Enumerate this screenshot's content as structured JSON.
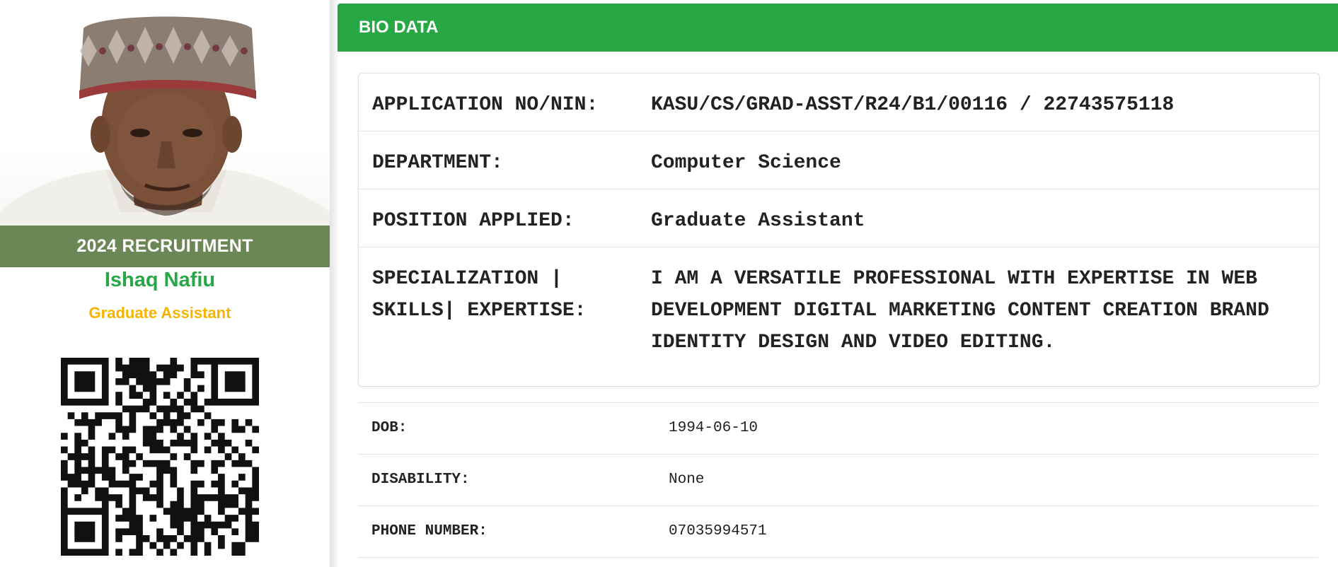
{
  "profile": {
    "banner": "2024 RECRUITMENT",
    "name": "Ishaq Nafiu",
    "role": "Graduate Assistant"
  },
  "bio": {
    "title": "BIO DATA",
    "card_rows": [
      {
        "label": "APPLICATION NO/NIN:",
        "value": "KASU/CS/GRAD-ASST/R24/B1/00116 / 22743575118"
      },
      {
        "label": "DEPARTMENT:",
        "value": "Computer Science"
      },
      {
        "label": "POSITION APPLIED:",
        "value": "Graduate Assistant"
      },
      {
        "label": "SPECIALIZATION | SKILLS| EXPERTISE:",
        "value": "I AM A VERSATILE PROFESSIONAL WITH EXPERTISE IN WEB DEVELOPMENT DIGITAL MARKETING CONTENT CREATION BRAND IDENTITY DESIGN AND VIDEO EDITING."
      }
    ],
    "details": [
      {
        "label": "DOB:",
        "value": "1994-06-10"
      },
      {
        "label": "DISABILITY:",
        "value": "None"
      },
      {
        "label": "PHONE NUMBER:",
        "value": "07035994571"
      }
    ]
  },
  "colors": {
    "header_green": "#28a745",
    "name_green": "#28a745",
    "role_yellow": "#f4b400",
    "banner_overlay": "#56763e"
  }
}
